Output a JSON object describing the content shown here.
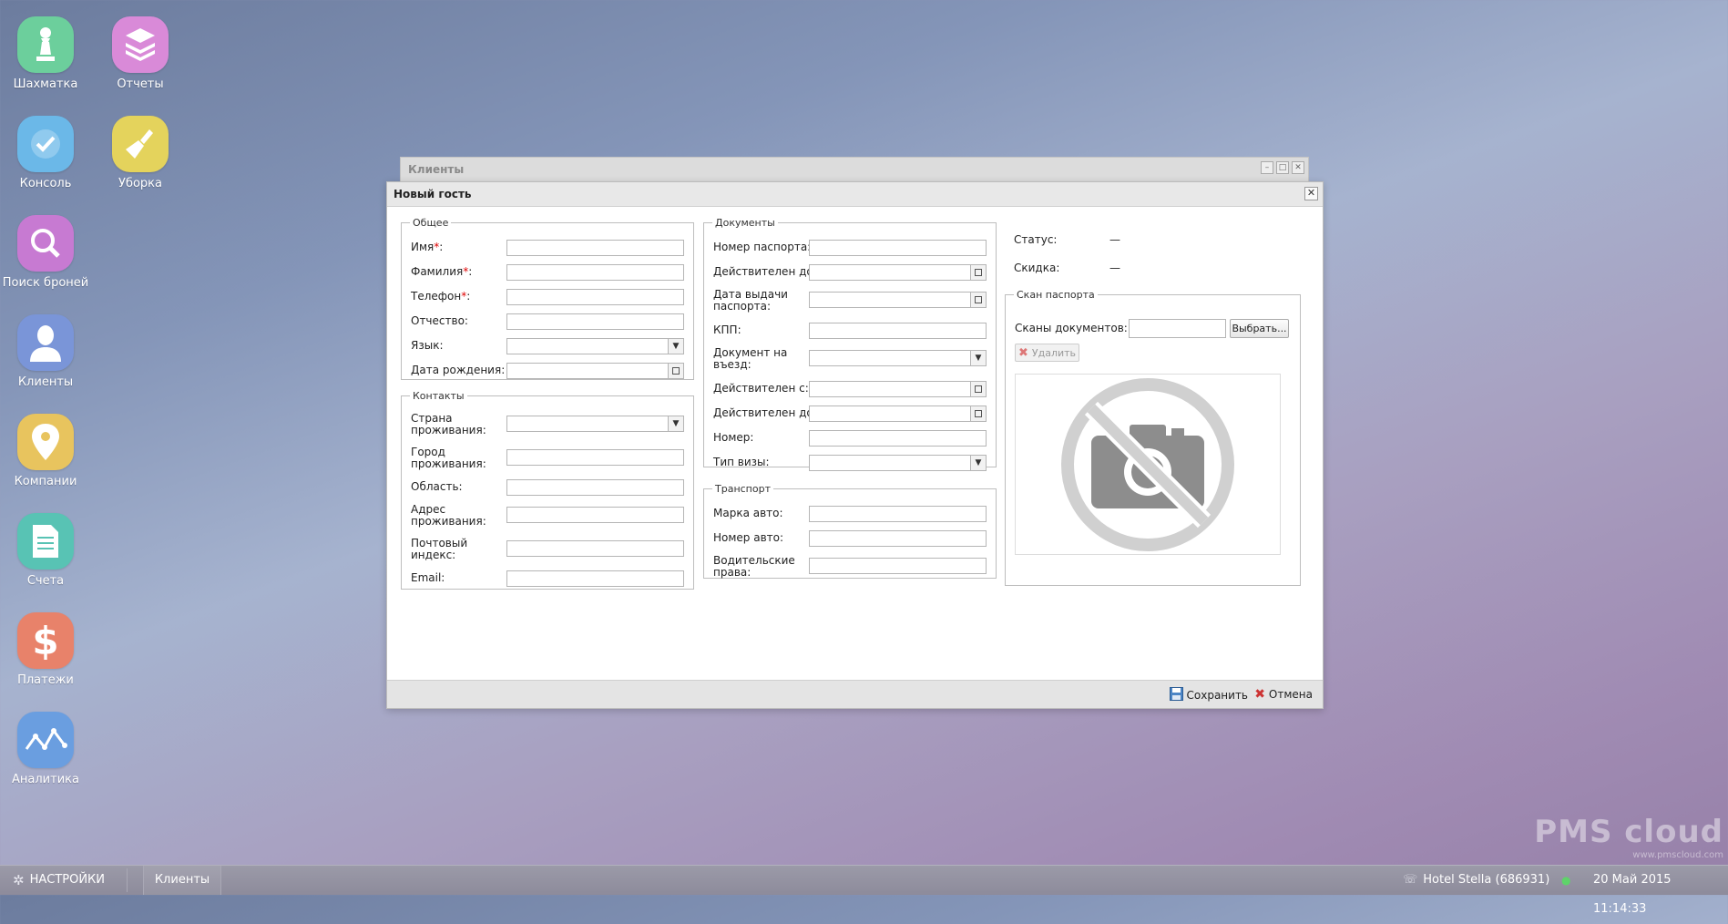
{
  "desktop_icons": [
    {
      "label": "Шахматка",
      "icon": "chess-pawn-icon",
      "color": "#6ccf9c"
    },
    {
      "label": "Отчеты",
      "icon": "books-icon",
      "color": "#d98ad8"
    },
    {
      "label": "Консоль",
      "icon": "checkmark-icon",
      "color": "#6bb8e8"
    },
    {
      "label": "Уборка",
      "icon": "broom-icon",
      "color": "#e4d35c"
    },
    {
      "label": "Поиск броней",
      "icon": "magnifier-icon",
      "color": "#c77ad2"
    },
    {
      "label": "Клиенты",
      "icon": "person-icon",
      "color": "#7a95d8"
    },
    {
      "label": "Компании",
      "icon": "map-pin-icon",
      "color": "#e8c45e"
    },
    {
      "label": "Счета",
      "icon": "document-icon",
      "color": "#58c3b4"
    },
    {
      "label": "Платежи",
      "icon": "dollar-icon",
      "color": "#e8826a"
    },
    {
      "label": "Аналитика",
      "icon": "chart-line-icon",
      "color": "#6a9ee0"
    }
  ],
  "background_window": {
    "title": "Клиенты"
  },
  "dialog": {
    "title": "Новый гость",
    "general": {
      "legend": "Общее",
      "fields": [
        {
          "label": "Имя",
          "required": "*",
          "suffix": ":"
        },
        {
          "label": "Фамилия",
          "required": "*",
          "suffix": ":"
        },
        {
          "label": "Телефон",
          "required": "*",
          "suffix": ":"
        },
        {
          "label": "Отчество:"
        },
        {
          "label": "Язык:"
        },
        {
          "label": "Дата рождения:"
        }
      ]
    },
    "contacts": {
      "legend": "Контакты",
      "fields": [
        {
          "label": "Страна\nпроживания:"
        },
        {
          "label": "Город\nпроживания:"
        },
        {
          "label": "Область:"
        },
        {
          "label": "Адрес\nпроживания:"
        },
        {
          "label": "Почтовый\nиндекс:"
        },
        {
          "label": "Email:"
        }
      ]
    },
    "documents": {
      "legend": "Документы",
      "fields": [
        {
          "label": "Номер паспорта:"
        },
        {
          "label": "Действителен до:"
        },
        {
          "label": "Дата выдачи\nпаспорта:"
        },
        {
          "label": "КПП:"
        },
        {
          "label": "Документ на\nвъезд:"
        },
        {
          "label": "Действителен с:"
        },
        {
          "label": "Действителен до:"
        },
        {
          "label": "Номер:"
        },
        {
          "label": "Тип визы:"
        }
      ]
    },
    "transport": {
      "legend": "Транспорт",
      "fields": [
        {
          "label": "Марка авто:"
        },
        {
          "label": "Номер авто:"
        },
        {
          "label": "Водительские\nправа:"
        }
      ]
    },
    "status": {
      "label": "Статус:",
      "value": "—"
    },
    "discount": {
      "label": "Скидка:",
      "value": "—"
    },
    "passport_scan": {
      "legend": "Скан паспорта",
      "scans_label": "Сканы документов:",
      "choose_button": "Выбрать...",
      "delete_button": "Удалить"
    },
    "footer": {
      "save": "Сохранить",
      "cancel": "Отмена"
    }
  },
  "taskbar": {
    "settings": "НАСТРОЙКИ",
    "window_item": "Клиенты",
    "hotel": "Hotel Stella (686931)",
    "datetime": "20 Май 2015 11:14:33"
  },
  "watermark": {
    "brand": "PMS cloud",
    "url": "www.pmscloud.com"
  }
}
